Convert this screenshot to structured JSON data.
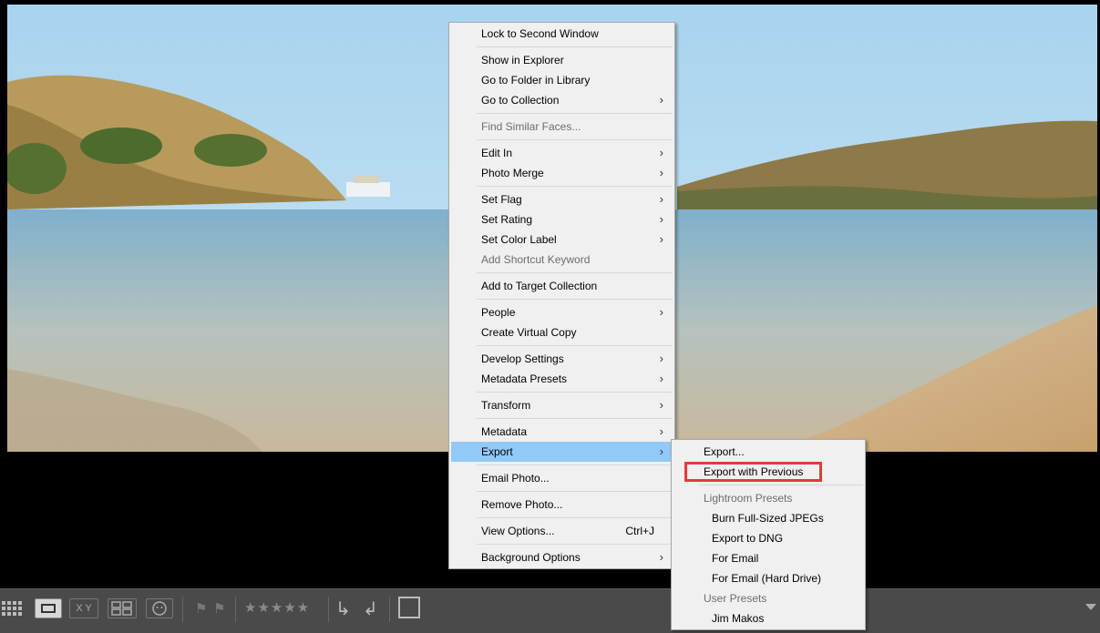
{
  "context_menu": {
    "items": [
      {
        "label": "Lock to Second Window",
        "disabled": false
      },
      {
        "label": "Show in Explorer"
      },
      {
        "label": "Go to Folder in Library"
      },
      {
        "label": "Go to Collection"
      },
      {
        "label": "Find Similar Faces..."
      },
      {
        "label": "Edit In"
      },
      {
        "label": "Photo Merge"
      },
      {
        "label": "Set Flag"
      },
      {
        "label": "Set Rating"
      },
      {
        "label": "Set Color Label"
      },
      {
        "label": "Add Shortcut Keyword"
      },
      {
        "label": "Add to Target Collection"
      },
      {
        "label": "People"
      },
      {
        "label": "Create Virtual Copy"
      },
      {
        "label": "Develop Settings"
      },
      {
        "label": "Metadata Presets"
      },
      {
        "label": "Transform"
      },
      {
        "label": "Metadata"
      },
      {
        "label": "Export"
      },
      {
        "label": "Email Photo..."
      },
      {
        "label": "Remove Photo..."
      },
      {
        "label": "View Options...",
        "shortcut": "Ctrl+J"
      },
      {
        "label": "Background Options"
      }
    ],
    "submenu_arrow": "›"
  },
  "export_submenu": {
    "items": [
      {
        "label": "Export..."
      },
      {
        "label": "Export with Previous"
      },
      {
        "label": "Lightroom Presets"
      },
      {
        "label": "Burn Full-Sized JPEGs"
      },
      {
        "label": "Export to DNG"
      },
      {
        "label": "For Email"
      },
      {
        "label": "For Email (Hard Drive)"
      },
      {
        "label": "User Presets"
      },
      {
        "label": "Jim Makos"
      }
    ]
  },
  "toolbar": {
    "xy_label": "X Y",
    "stars": "★★★★★",
    "icons": [
      "grid-view-icon",
      "loupe-view-icon",
      "compare-view-icon",
      "survey-view-icon",
      "people-view-icon",
      "flag-icon",
      "reject-flag-icon",
      "rotate-left-icon",
      "rotate-right-icon",
      "crop-icon",
      "toolbar-menu-arrow-icon"
    ]
  },
  "colors": {
    "menu_bg": "#f0f0f0",
    "highlight": "#91c9f7",
    "callout": "#e23b3b",
    "toolbar_bg": "#4a4a4a"
  }
}
